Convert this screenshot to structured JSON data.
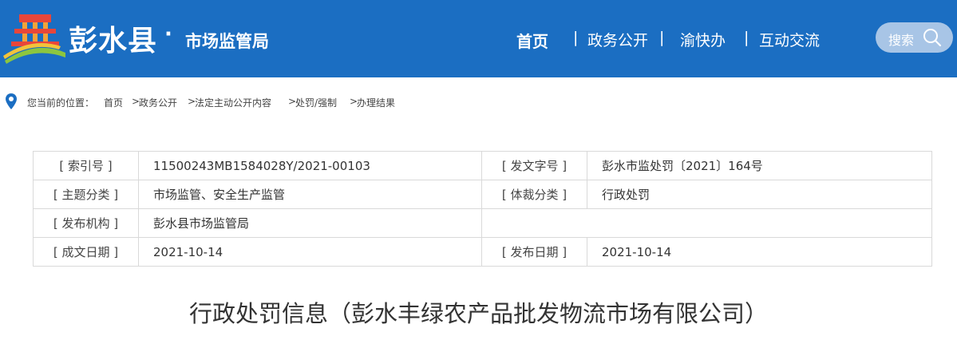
{
  "site": {
    "name": "彭水县",
    "dot": "·",
    "department": "市场监管局"
  },
  "nav": {
    "items": [
      {
        "label": "首页"
      },
      {
        "label": "政务公开"
      },
      {
        "label": "渝快办"
      },
      {
        "label": "互动交流"
      }
    ],
    "separator": "|"
  },
  "search": {
    "label": "搜索"
  },
  "breadcrumb": {
    "prefix": "您当前的位置：",
    "items": [
      "首页",
      "政务公开",
      "法定主动公开内容",
      "处罚/强制",
      "办理结果"
    ],
    "arrow": ">"
  },
  "info_table": {
    "rows": [
      {
        "label1": "[ 索引号 ]",
        "value1": "11500243MB1584028Y/2021-00103",
        "label2": "[ 发文字号 ]",
        "value2": "彭水市监处罚〔2021〕164号"
      },
      {
        "label1": "[ 主题分类 ]",
        "value1": "市场监管、安全生产监管",
        "label2": "[ 体裁分类 ]",
        "value2": "行政处罚"
      },
      {
        "label1": "[ 发布机构 ]",
        "value1": "彭水县市场监管局",
        "label2": "",
        "value2": ""
      },
      {
        "label1": "[ 成文日期 ]",
        "value1": "2021-10-14",
        "label2": "[ 发布日期 ]",
        "value2": "2021-10-14"
      }
    ]
  },
  "article": {
    "title": "行政处罚信息（彭水丰绿农产品批发物流市场有限公司）"
  },
  "colors": {
    "header_bg": "#1b6ec2",
    "search_bg": "#a8c5e6",
    "pin": "#1b6ec2"
  }
}
